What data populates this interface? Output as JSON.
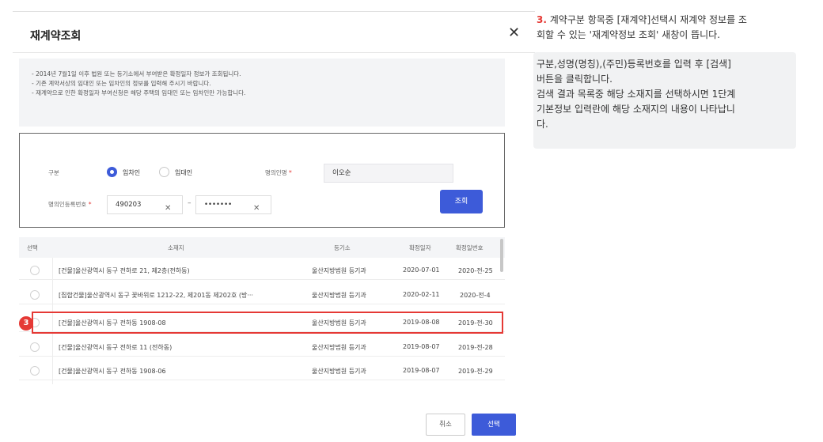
{
  "modal": {
    "title": "재계약조회",
    "close_glyph": "✕"
  },
  "notice": [
    "- 2014년 7월1일 이후 법원 또는 등기소에서 부여받은 확정일자 정보가 조회됩니다.",
    "- 기존 계약서상의 임대인 또는 임차인의 정보를 입력해 주시기 바랍니다.",
    "- 재계약으로 인한 확정일자 부여신청은 해당 주택의 임대인 또는 임차인만 가능합니다."
  ],
  "search": {
    "type_label": "구분",
    "option_tenant": "임차인",
    "option_landlord": "임대인",
    "selected_option": "임차인",
    "name_label": "명의인명",
    "required_mark": "*",
    "name_value": "이오순",
    "id_label": "명의인등록번호",
    "id_front": "490203",
    "id_back": "•••••••",
    "clear_glyph": "✕",
    "dash": "–",
    "search_button": "조회"
  },
  "table": {
    "headers": [
      "선택",
      "소재지",
      "등기소",
      "확정일자",
      "확정일번호"
    ],
    "rows": [
      {
        "address": "[건물]울산광역시 동구 전하로 21, 제2층(전하동)",
        "office": "울산지방법원 등기과",
        "date": "2020-07-01",
        "number": "2020-전-25"
      },
      {
        "address": "[집합건물]울산광역시 동구 꽃바위로 1212-22, 제201동 제202호 (방···",
        "office": "울산지방법원 등기과",
        "date": "2020-02-11",
        "number": "2020-전-4"
      },
      {
        "address": "[건물]울산광역시 동구 전하동 1908-08",
        "office": "울산지방법원 등기과",
        "date": "2019-08-08",
        "number": "2019-전-30"
      },
      {
        "address": "[건물]울산광역시 동구 전하로 11 (전하동)",
        "office": "울산지방법원 등기과",
        "date": "2019-08-07",
        "number": "2019-전-28"
      },
      {
        "address": "[건물]울산광역시 동구 전하동 1908-06",
        "office": "울산지방법원 등기과",
        "date": "2019-08-07",
        "number": "2019-전-29"
      }
    ]
  },
  "step_badge": "3",
  "footer": {
    "cancel": "취소",
    "select": "선택"
  },
  "explanation": {
    "step_number": "3.",
    "line1_a": " 계약구분 항목중 [재계약]선택시 재계약 정보를 조",
    "line1_b": "회할 수 있는 '재계약정보 조회' 새창이 뜹니다.",
    "p2_lines": [
      "구분,성명(명칭),(주민)등록번호를 입력 후 [검색]",
      "버튼을 클릭합니다.",
      "검색 결과 목록중 해당 소재지를 선택하시면 1단계",
      "기본정보 입력란에 해당 소재지의 내용이 나타납니",
      "다."
    ]
  },
  "colors": {
    "accent": "#3d5bd9",
    "highlight": "#e53935"
  }
}
